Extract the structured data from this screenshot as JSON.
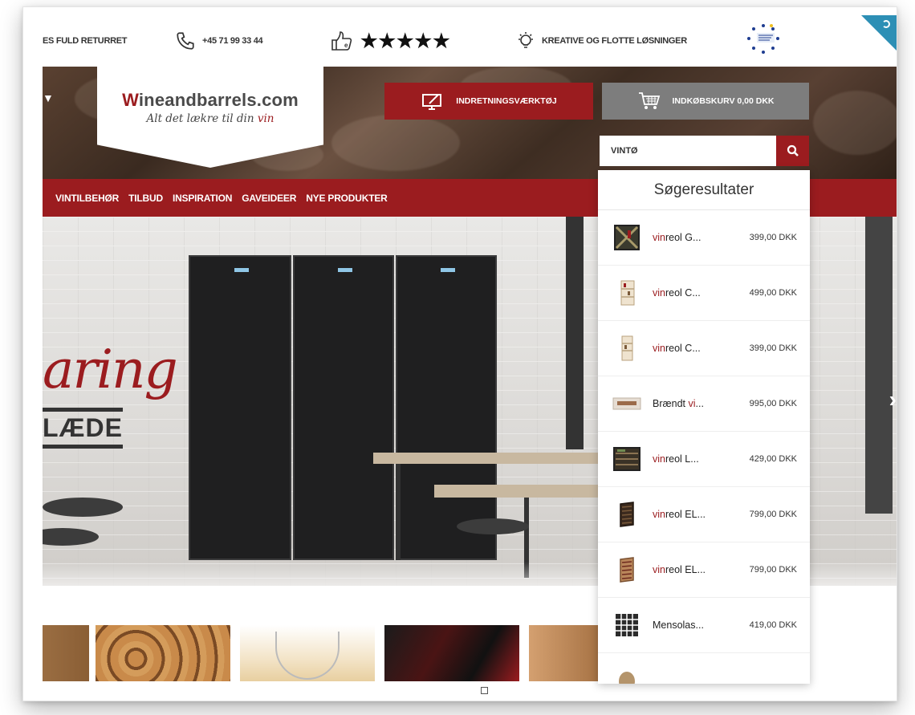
{
  "topbar": {
    "returns": "ES FULD RETURRET",
    "phone": "+45 71 99 33 44",
    "stars": "★★★★★",
    "ideas": "KREATIVE OG FLOTTE LØSNINGER",
    "icons": [
      "phone-icon",
      "thumbs-up-icon",
      "lightbulb-icon",
      "ecommerce-europe-badge"
    ]
  },
  "header": {
    "logo_name_accent": "W",
    "logo_name_rest": "ineandbarrels.com",
    "logo_tag_plain": "Alt det lækre til din ",
    "logo_tag_accent": "vin",
    "tool_label": "INDRETNINGSVÆRKTØJ",
    "cart_label": "INDKØBSKURV 0,00 DKK",
    "search_value": "VINTØ"
  },
  "nav": {
    "items": [
      "VINTILBEHØR",
      "TILBUD",
      "INSPIRATION",
      "GAVEIDEER",
      "NYE PRODUKTER"
    ]
  },
  "hero": {
    "script_text": "aring",
    "title_text": "LÆDE"
  },
  "search_results": {
    "title": "Søgeresultater",
    "items": [
      {
        "hl": "vin",
        "rest": "reol G...",
        "price": "399,00 DKK",
        "thumb": "x-rack"
      },
      {
        "hl": "vin",
        "rest": "reol C...",
        "price": "499,00 DKK",
        "thumb": "cube-rack"
      },
      {
        "hl": "vin",
        "rest": "reol C...",
        "price": "399,00 DKK",
        "thumb": "cube-rack"
      },
      {
        "pre": "Brændt ",
        "hl": "vi",
        "rest": "...",
        "price": "995,00 DKK",
        "thumb": "box"
      },
      {
        "hl": "vin",
        "rest": "reol L...",
        "price": "429,00 DKK",
        "thumb": "cabinet"
      },
      {
        "hl": "vin",
        "rest": "reol EL...",
        "price": "799,00 DKK",
        "thumb": "dark-rack"
      },
      {
        "hl": "vin",
        "rest": "reol EL...",
        "price": "799,00 DKK",
        "thumb": "light-rack"
      },
      {
        "pre": "Mensolas...",
        "hl": "",
        "rest": "",
        "price": "419,00 DKK",
        "thumb": "grid-rack"
      }
    ]
  },
  "colors": {
    "brand_red": "#9b1c1f",
    "cart_gray": "#7d7d7d"
  }
}
